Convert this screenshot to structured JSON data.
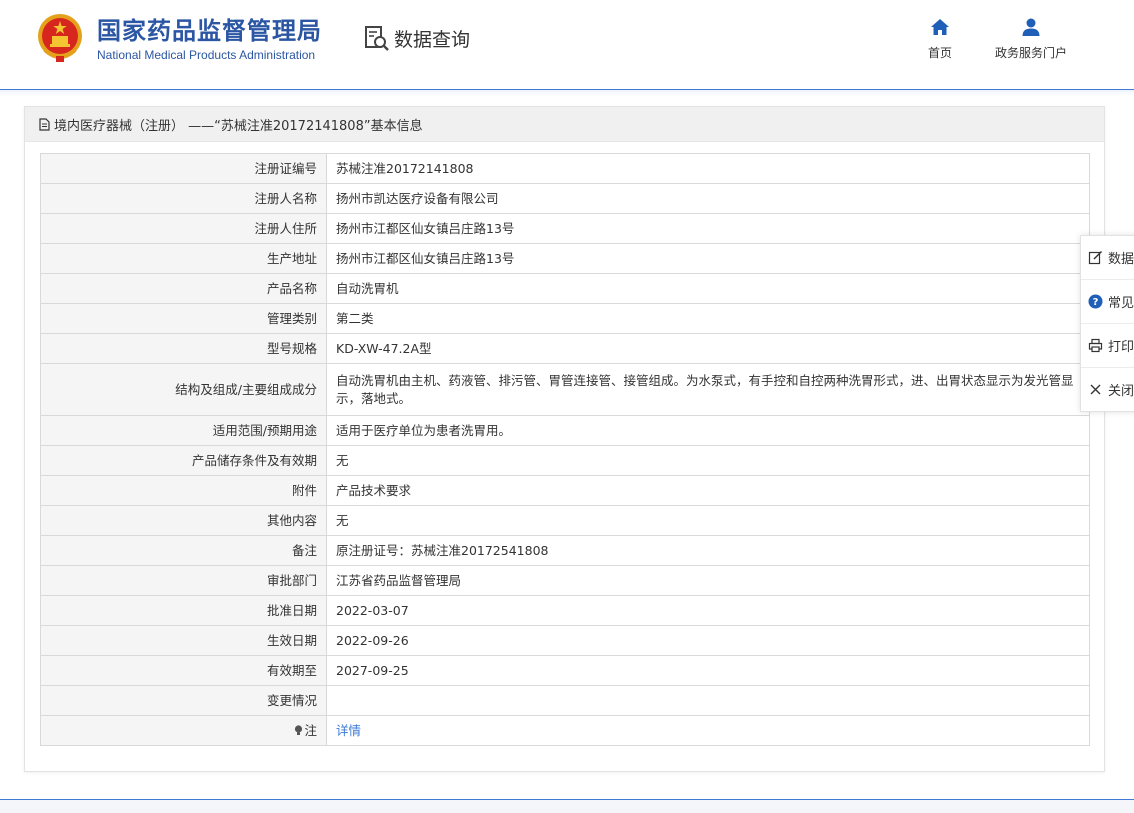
{
  "header": {
    "org_name_cn": "国家药品监督管理局",
    "org_name_en": "National Medical Products Administration",
    "section_title": "数据查询",
    "nav": [
      {
        "label": "首页",
        "icon": "home-icon"
      },
      {
        "label": "政务服务门户",
        "icon": "user-icon"
      }
    ]
  },
  "panel": {
    "title": "境内医疗器械（注册） ——“苏械注准20172141808”基本信息"
  },
  "rows": [
    {
      "label": "注册证编号",
      "value": "苏械注准20172141808"
    },
    {
      "label": "注册人名称",
      "value": "扬州市凯达医疗设备有限公司"
    },
    {
      "label": "注册人住所",
      "value": "扬州市江都区仙女镇吕庄路13号"
    },
    {
      "label": "生产地址",
      "value": "扬州市江都区仙女镇吕庄路13号"
    },
    {
      "label": "产品名称",
      "value": "自动洗胃机"
    },
    {
      "label": "管理类别",
      "value": "第二类"
    },
    {
      "label": "型号规格",
      "value": "KD-XW-47.2A型"
    },
    {
      "label": "结构及组成/主要组成成分",
      "value": "自动洗胃机由主机、药液管、排污管、胃管连接管、接管组成。为水泵式，有手控和自控两种洗胃形式，进、出胃状态显示为发光管显示，落地式。"
    },
    {
      "label": "适用范围/预期用途",
      "value": "适用于医疗单位为患者洗胃用。"
    },
    {
      "label": "产品储存条件及有效期",
      "value": "无"
    },
    {
      "label": "附件",
      "value": "产品技术要求"
    },
    {
      "label": "其他内容",
      "value": "无"
    },
    {
      "label": "备注",
      "value": "原注册证号：苏械注准20172541808"
    },
    {
      "label": "审批部门",
      "value": "江苏省药品监督管理局"
    },
    {
      "label": "批准日期",
      "value": "2022-03-07"
    },
    {
      "label": "生效日期",
      "value": "2022-09-26"
    },
    {
      "label": "有效期至",
      "value": "2027-09-25"
    },
    {
      "label": "变更情况",
      "value": ""
    },
    {
      "label": "注",
      "value": "详情"
    }
  ],
  "sidebar": [
    {
      "label": "数据",
      "icon": "edit-icon"
    },
    {
      "label": "常见",
      "icon": "help-icon"
    },
    {
      "label": "打印",
      "icon": "print-icon"
    },
    {
      "label": "关闭",
      "icon": "close-icon"
    }
  ],
  "colors": {
    "brand_blue": "#2b56a3",
    "link_blue": "#3c7ad6",
    "header_line": "#3f7bd4"
  }
}
